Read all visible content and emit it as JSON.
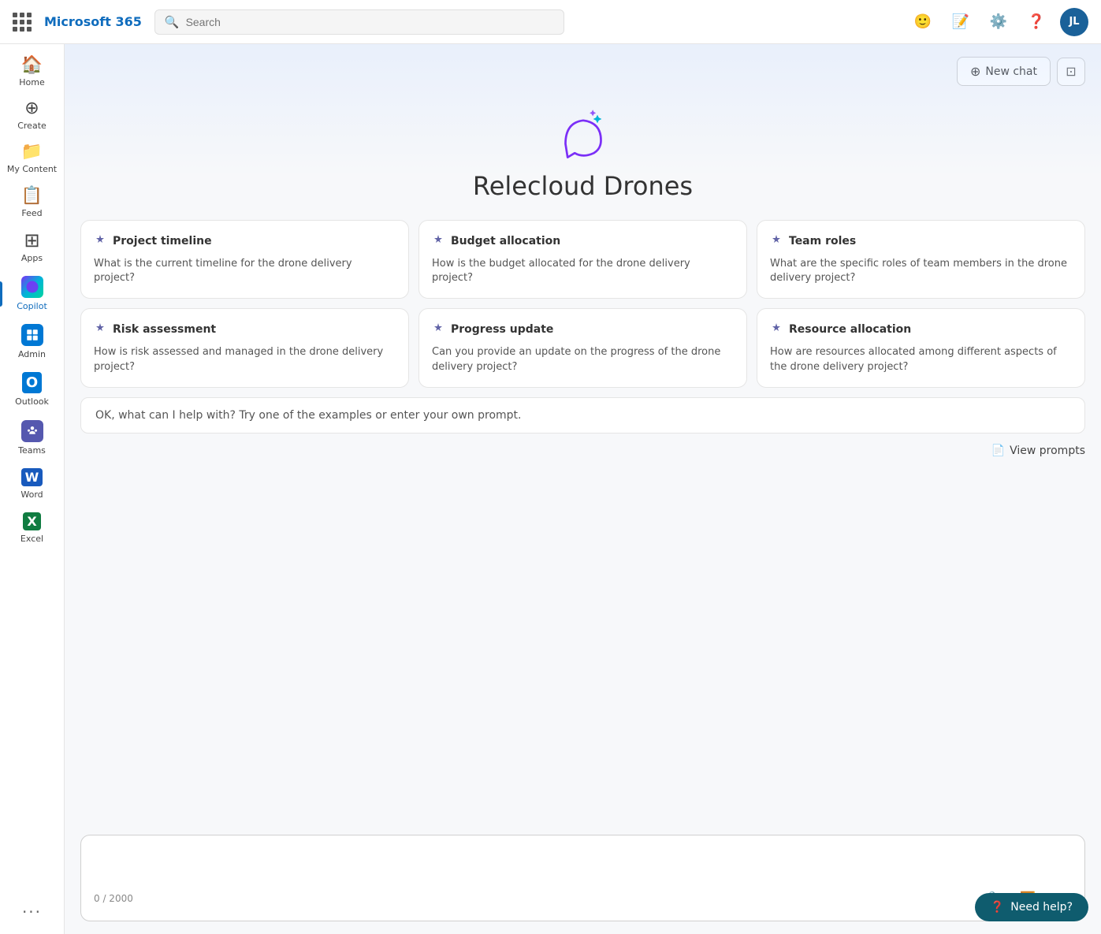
{
  "topbar": {
    "logo": "Microsoft 365",
    "search_placeholder": "Search",
    "avatar_initials": "JL"
  },
  "sidebar": {
    "items": [
      {
        "id": "home",
        "label": "Home",
        "icon": "🏠"
      },
      {
        "id": "create",
        "label": "Create",
        "icon": "➕"
      },
      {
        "id": "my-content",
        "label": "My Content",
        "icon": "📁"
      },
      {
        "id": "feed",
        "label": "Feed",
        "icon": "📋"
      },
      {
        "id": "apps",
        "label": "Apps",
        "icon": "⊞"
      },
      {
        "id": "copilot",
        "label": "Copilot",
        "icon": "copilot",
        "active": true
      },
      {
        "id": "admin",
        "label": "Admin",
        "icon": "admin"
      },
      {
        "id": "outlook",
        "label": "Outlook",
        "icon": "outlook"
      },
      {
        "id": "teams",
        "label": "Teams",
        "icon": "teams"
      },
      {
        "id": "word",
        "label": "Word",
        "icon": "word"
      },
      {
        "id": "excel",
        "label": "Excel",
        "icon": "excel"
      }
    ],
    "more_label": "···"
  },
  "copilot": {
    "new_chat_label": "New chat",
    "expand_icon": "⊡",
    "title": "Relecloud Drones",
    "cards": [
      {
        "id": "project-timeline",
        "title": "Project timeline",
        "body": "What is the current timeline for the drone delivery project?",
        "icon": "✦"
      },
      {
        "id": "budget-allocation",
        "title": "Budget allocation",
        "body": "How is the budget allocated for the drone delivery project?",
        "icon": "✦"
      },
      {
        "id": "team-roles",
        "title": "Team roles",
        "body": "What are the specific roles of team members in the drone delivery project?",
        "icon": "✦"
      },
      {
        "id": "risk-assessment",
        "title": "Risk assessment",
        "body": "How is risk assessed and managed in the drone delivery project?",
        "icon": "✦"
      },
      {
        "id": "progress-update",
        "title": "Progress update",
        "body": "Can you provide an update on the progress of the drone delivery project?",
        "icon": "✦"
      },
      {
        "id": "resource-allocation",
        "title": "Resource allocation",
        "body": "How are resources allocated among different aspects of the drone delivery project?",
        "icon": "✦"
      }
    ],
    "prompt_placeholder": "OK, what can I help with? Try one of the examples or enter your own prompt.",
    "view_prompts_label": "View prompts",
    "input_placeholder": "",
    "char_count": "0 / 2000"
  },
  "need_help": {
    "label": "Need help?"
  }
}
